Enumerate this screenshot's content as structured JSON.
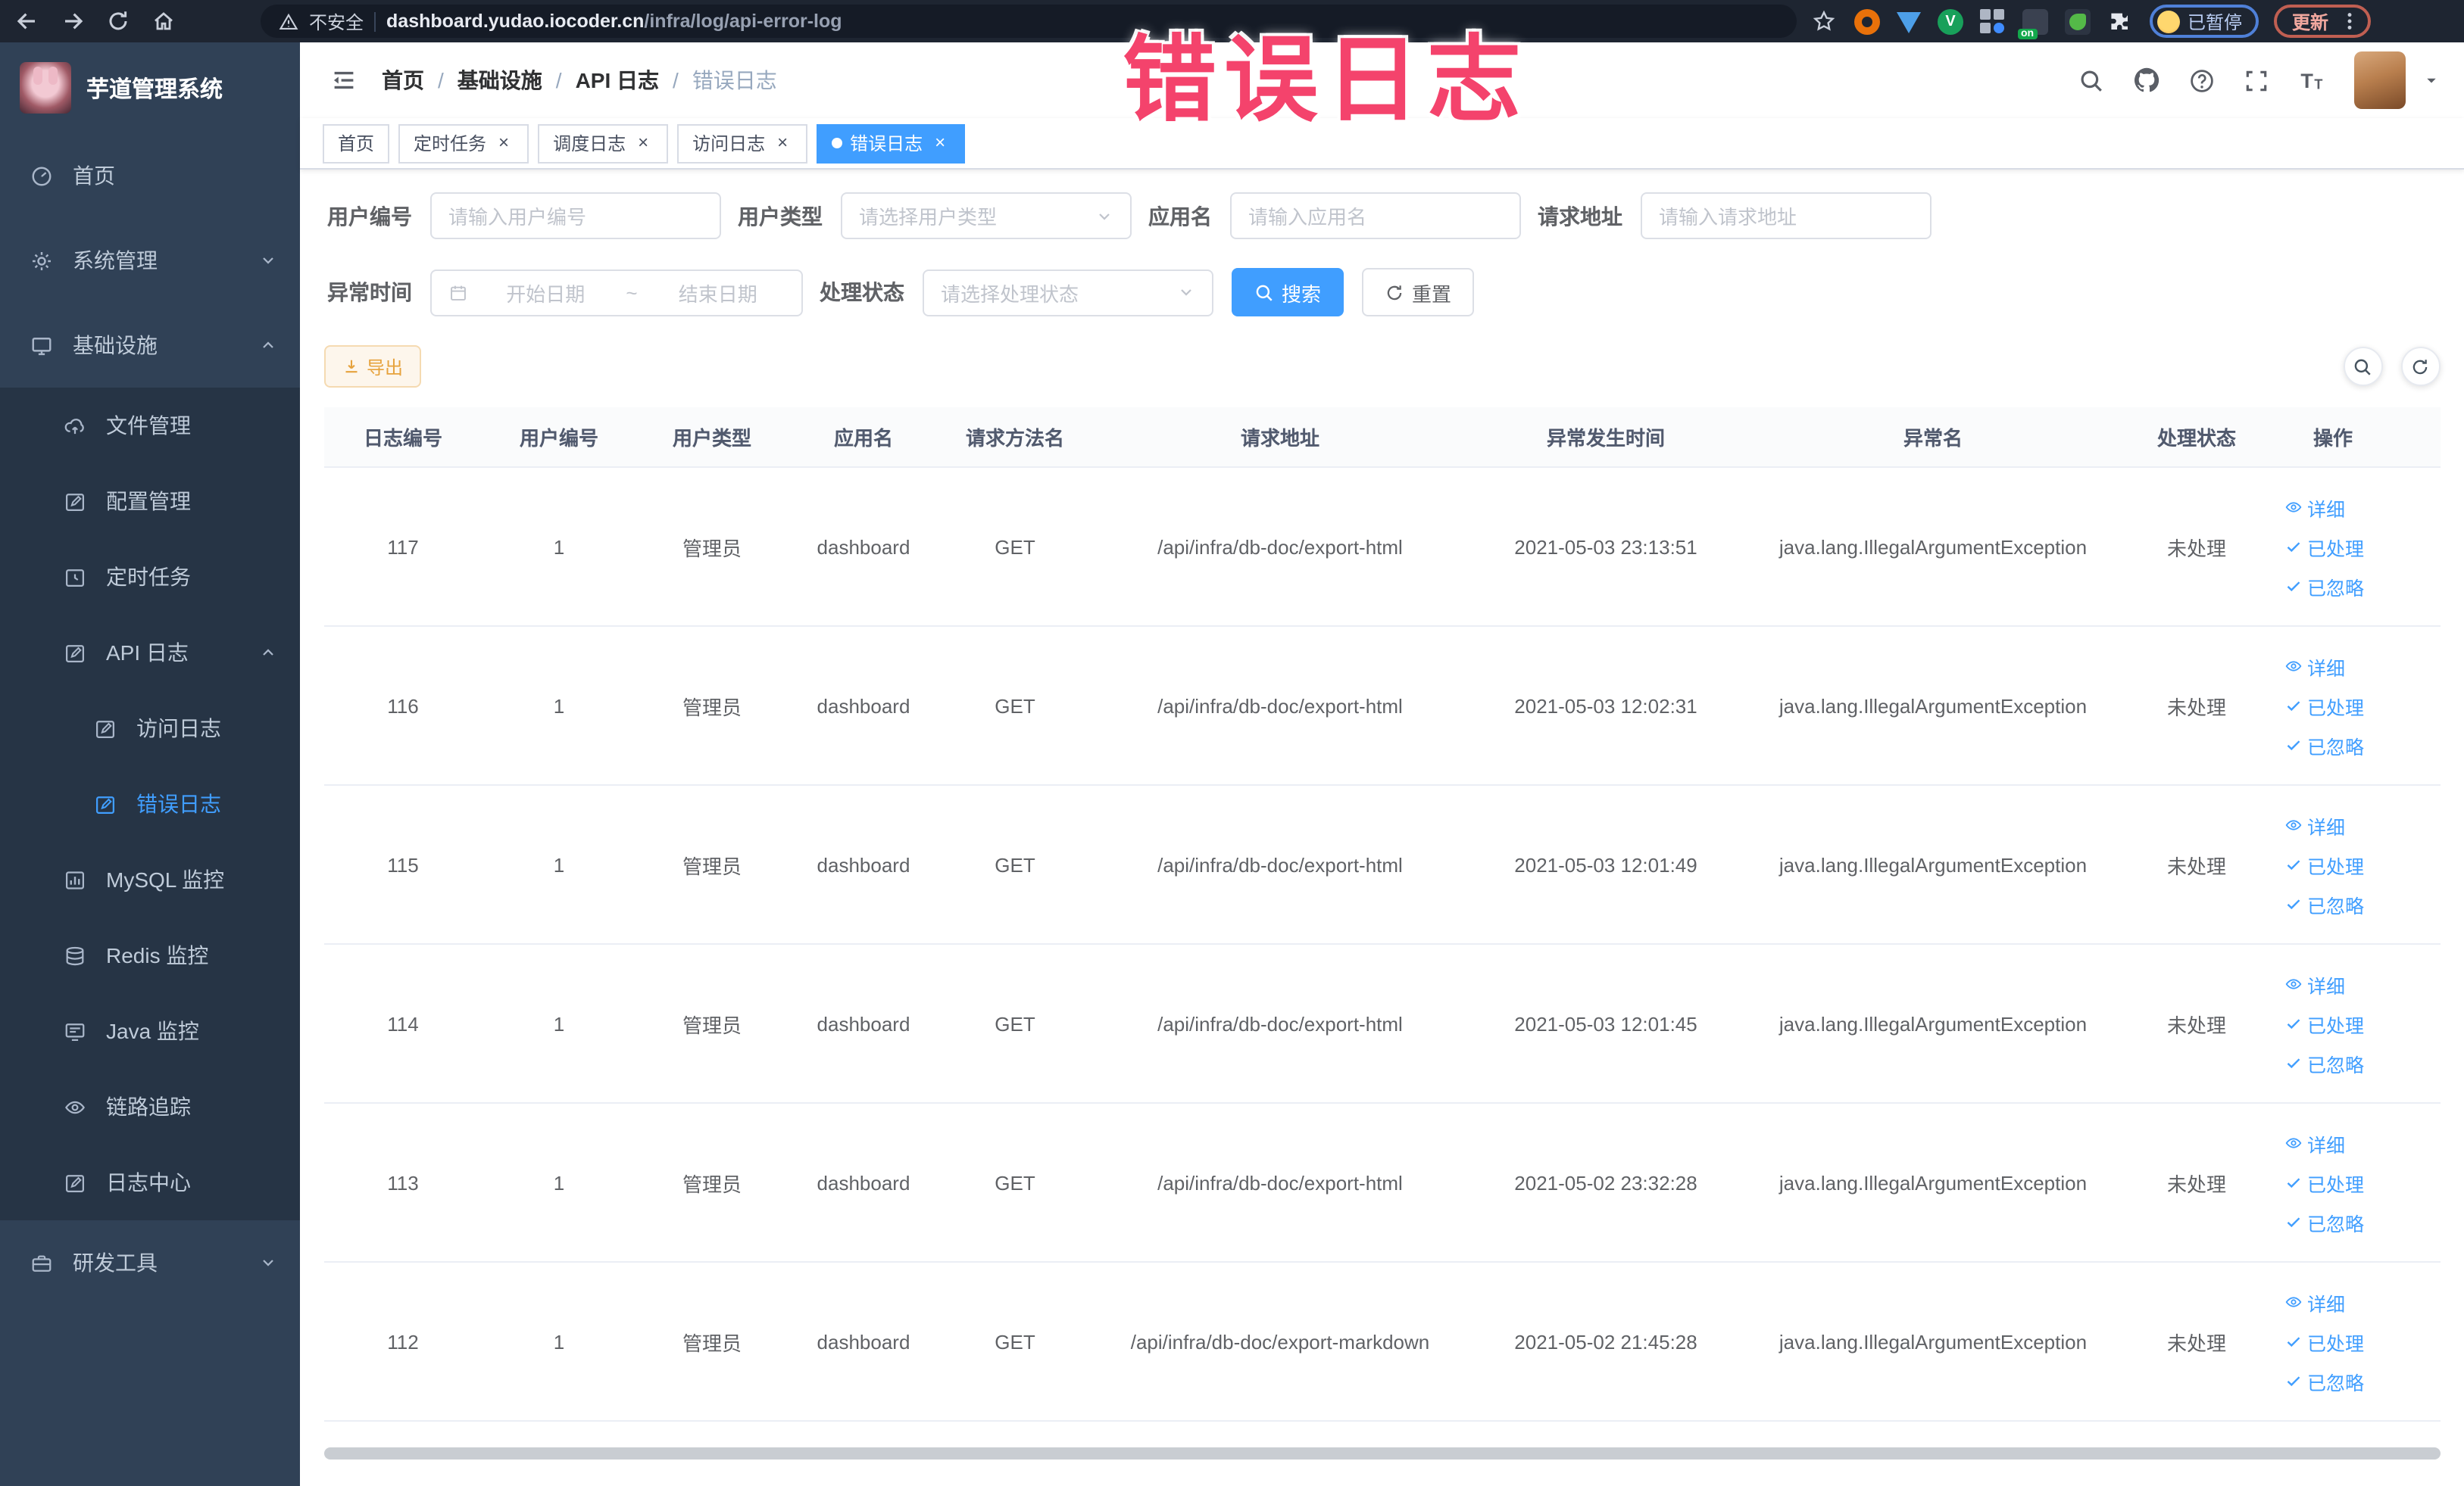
{
  "colors": {
    "accent": "#409eff",
    "warning": "#e6a23c",
    "annotation_pink": "#f4436c",
    "sidebar_bg": "#304156",
    "submenu_bg": "#263445"
  },
  "annotation": {
    "text": "错误日志"
  },
  "browser": {
    "security": "不安全",
    "url_domain": "dashboard.yudao.iocoder.cn",
    "url_path": "/infra/log/api-error-log",
    "extension_on_badge": "on",
    "extension_v_label": "V",
    "profile_status": "已暂停",
    "update_label": "更新"
  },
  "sidebar": {
    "logo_title": "芋道管理系统",
    "items": [
      {
        "label": "首页"
      },
      {
        "label": "系统管理"
      },
      {
        "label": "基础设施"
      },
      {
        "label": "文件管理"
      },
      {
        "label": "配置管理"
      },
      {
        "label": "定时任务"
      },
      {
        "label": "API 日志"
      },
      {
        "label": "访问日志"
      },
      {
        "label": "错误日志"
      },
      {
        "label": "MySQL 监控"
      },
      {
        "label": "Redis 监控"
      },
      {
        "label": "Java 监控"
      },
      {
        "label": "链路追踪"
      },
      {
        "label": "日志中心"
      },
      {
        "label": "研发工具"
      }
    ]
  },
  "breadcrumb": {
    "items": [
      "首页",
      "基础设施",
      "API 日志",
      "错误日志"
    ]
  },
  "tabs": [
    {
      "label": "首页"
    },
    {
      "label": "定时任务"
    },
    {
      "label": "调度日志"
    },
    {
      "label": "访问日志"
    },
    {
      "label": "错误日志"
    }
  ],
  "filters": {
    "user_id_label": "用户编号",
    "user_id_placeholder": "请输入用户编号",
    "user_type_label": "用户类型",
    "user_type_placeholder": "请选择用户类型",
    "app_name_label": "应用名",
    "app_name_placeholder": "请输入应用名",
    "request_url_label": "请求地址",
    "request_url_placeholder": "请输入请求地址",
    "exception_time_label": "异常时间",
    "date_start_placeholder": "开始日期",
    "date_separator": "~",
    "date_end_placeholder": "结束日期",
    "process_status_label": "处理状态",
    "process_status_placeholder": "请选择处理状态",
    "search_label": "搜索",
    "reset_label": "重置"
  },
  "toolbar": {
    "export_label": "导出"
  },
  "table": {
    "columns": [
      "日志编号",
      "用户编号",
      "用户类型",
      "应用名",
      "请求方法名",
      "请求地址",
      "异常发生时间",
      "异常名",
      "处理状态",
      "操作"
    ],
    "actions": {
      "detail": "详细",
      "processed": "已处理",
      "ignored": "已忽略"
    },
    "rows": [
      {
        "id": "117",
        "user_id": "1",
        "user_type": "管理员",
        "app_name": "dashboard",
        "method": "GET",
        "url": "/api/infra/db-doc/export-html",
        "time": "2021-05-03 23:13:51",
        "exception": "java.lang.IllegalArgumentException",
        "status": "未处理"
      },
      {
        "id": "116",
        "user_id": "1",
        "user_type": "管理员",
        "app_name": "dashboard",
        "method": "GET",
        "url": "/api/infra/db-doc/export-html",
        "time": "2021-05-03 12:02:31",
        "exception": "java.lang.IllegalArgumentException",
        "status": "未处理"
      },
      {
        "id": "115",
        "user_id": "1",
        "user_type": "管理员",
        "app_name": "dashboard",
        "method": "GET",
        "url": "/api/infra/db-doc/export-html",
        "time": "2021-05-03 12:01:49",
        "exception": "java.lang.IllegalArgumentException",
        "status": "未处理"
      },
      {
        "id": "114",
        "user_id": "1",
        "user_type": "管理员",
        "app_name": "dashboard",
        "method": "GET",
        "url": "/api/infra/db-doc/export-html",
        "time": "2021-05-03 12:01:45",
        "exception": "java.lang.IllegalArgumentException",
        "status": "未处理"
      },
      {
        "id": "113",
        "user_id": "1",
        "user_type": "管理员",
        "app_name": "dashboard",
        "method": "GET",
        "url": "/api/infra/db-doc/export-html",
        "time": "2021-05-02 23:32:28",
        "exception": "java.lang.IllegalArgumentException",
        "status": "未处理"
      },
      {
        "id": "112",
        "user_id": "1",
        "user_type": "管理员",
        "app_name": "dashboard",
        "method": "GET",
        "url": "/api/infra/db-doc/export-markdown",
        "time": "2021-05-02 21:45:28",
        "exception": "java.lang.IllegalArgumentException",
        "status": "未处理"
      }
    ]
  }
}
